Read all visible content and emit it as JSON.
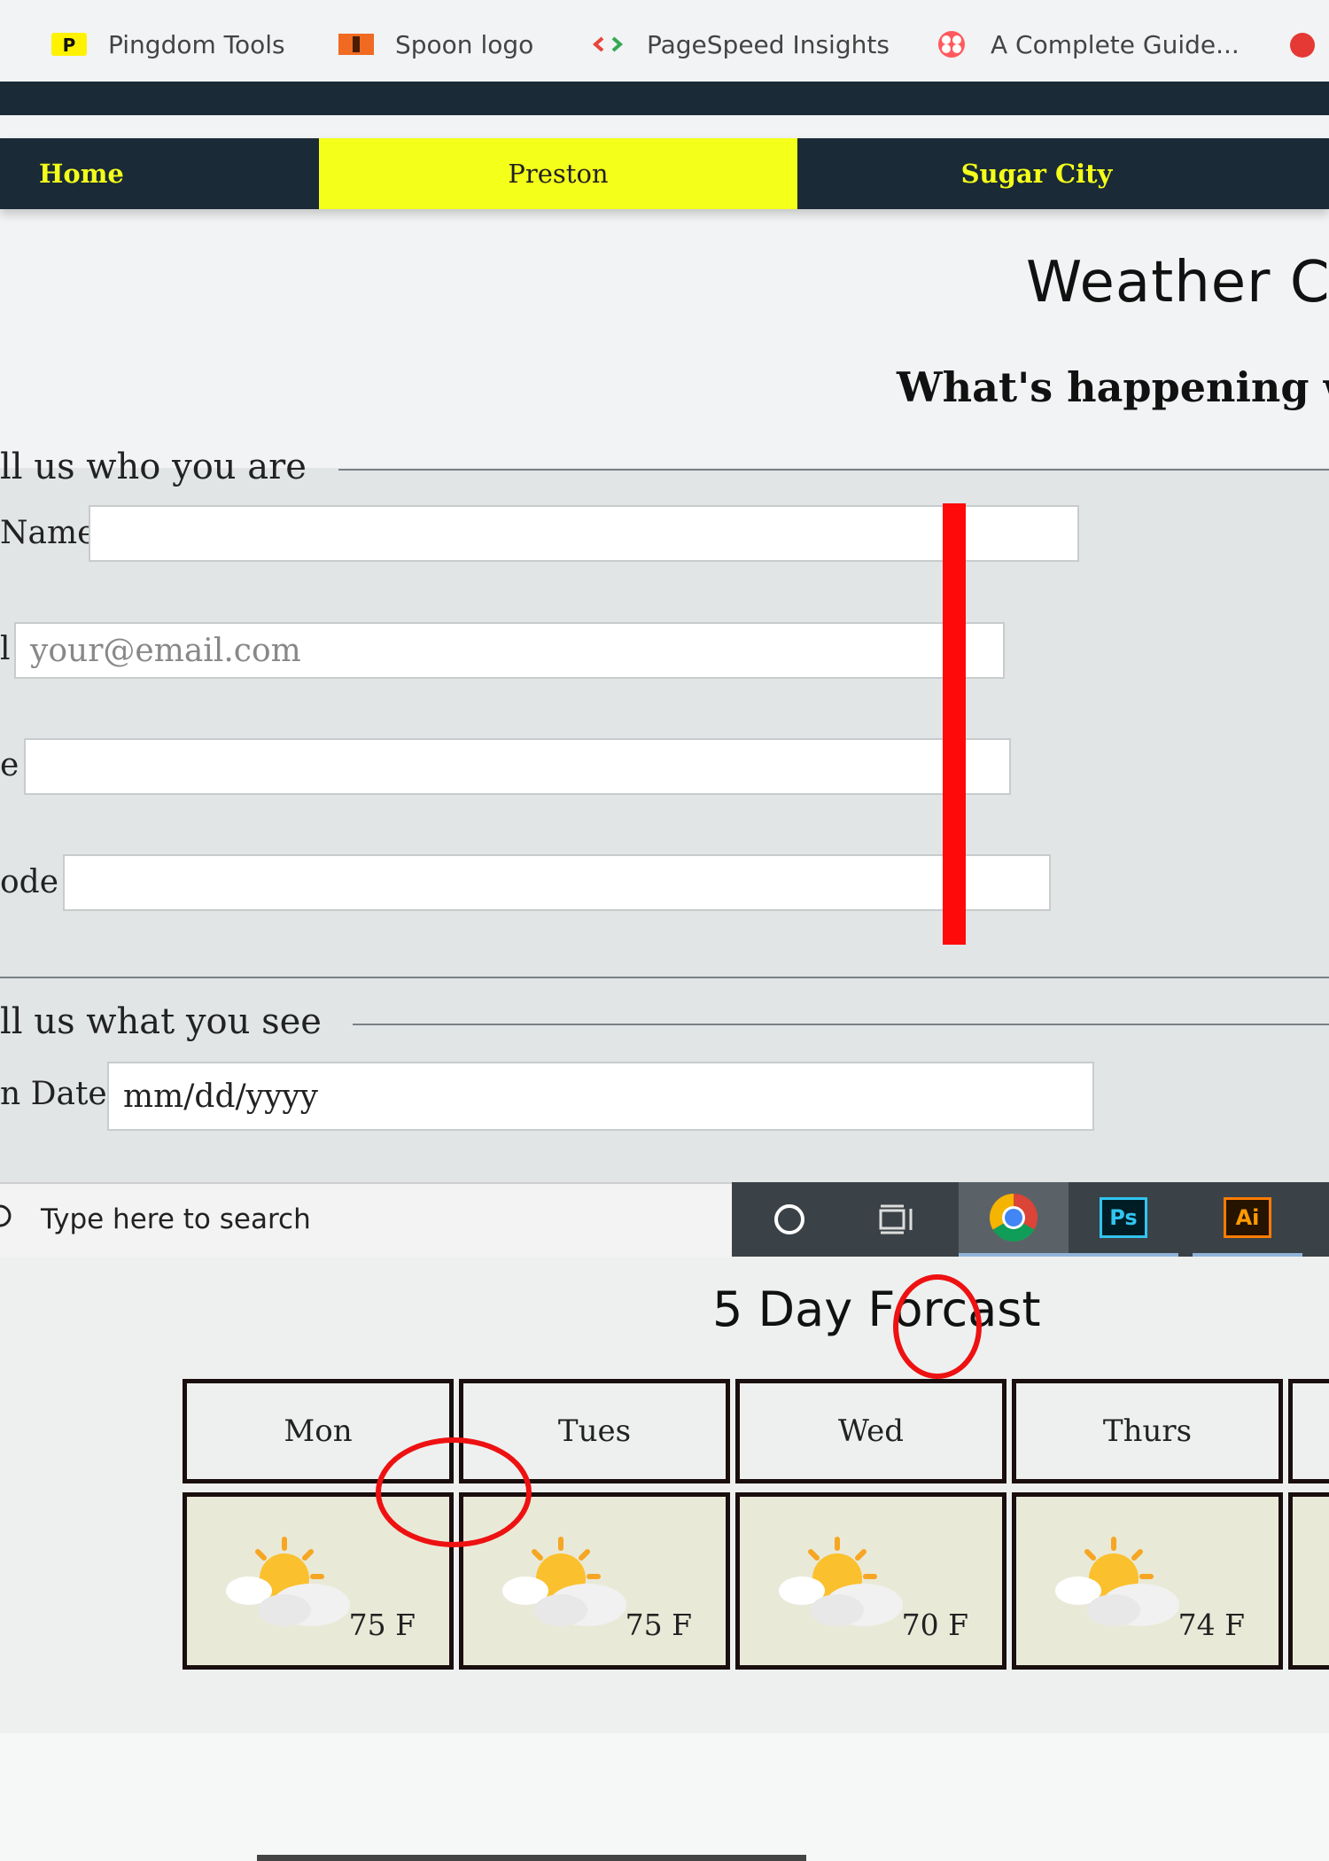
{
  "bookmarks": [
    {
      "label": "Pingdom Tools",
      "icon": "pingdom-icon"
    },
    {
      "label": "Spoon logo",
      "icon": "spoon-icon"
    },
    {
      "label": "PageSpeed Insights",
      "icon": "pagespeed-icon"
    },
    {
      "label": "A Complete Guide...",
      "icon": "guide-icon"
    }
  ],
  "nav": {
    "items": [
      {
        "label": "Home"
      },
      {
        "label": "Preston"
      },
      {
        "label": "Sugar City"
      }
    ]
  },
  "header": {
    "title": "Weather C",
    "subtitle": "What's happening w"
  },
  "form": {
    "section1_legend": "ll us who you are",
    "name_label": "Name",
    "email_label": "l",
    "email_placeholder": "your@email.com",
    "third_label": "e",
    "zip_label": "ode",
    "section2_legend": "ll us what you see",
    "date_label": "n Date",
    "date_placeholder": "mm/dd/yyyy"
  },
  "taskbar": {
    "search_placeholder": "Type here to search",
    "ps_label": "Ps",
    "ai_label": "Ai"
  },
  "forecast": {
    "title": "5 Day Forcast",
    "days": [
      {
        "day": "Mon",
        "temp": "75 F"
      },
      {
        "day": "Tues",
        "temp": "75 F"
      },
      {
        "day": "Wed",
        "temp": "70 F"
      },
      {
        "day": "Thurs",
        "temp": "74 F"
      }
    ]
  },
  "colors": {
    "nav_bg": "#1a2a36",
    "accent_yellow": "#f4ff1a",
    "form_bg": "#e1e5e6",
    "annotation_red": "#ff0a0a"
  }
}
